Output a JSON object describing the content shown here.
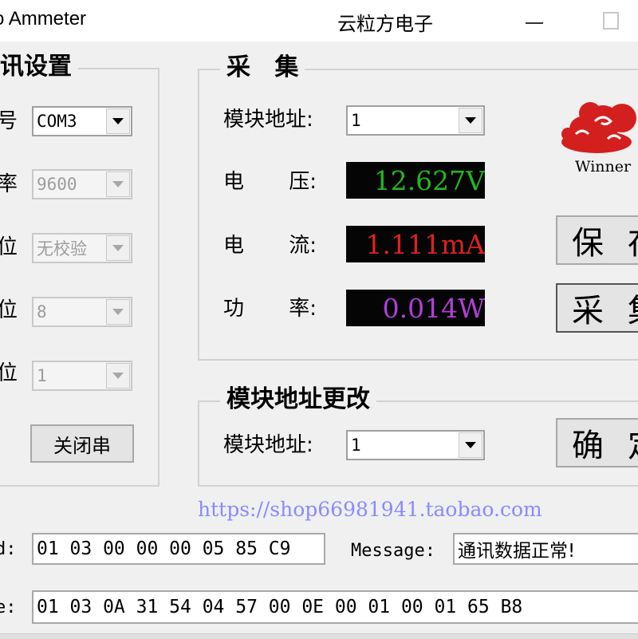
{
  "window": {
    "title": "o Ammeter",
    "vendor": "云粒方电子"
  },
  "comm_settings": {
    "title": "讯设置",
    "rows": [
      {
        "label": "号",
        "value": "COM3",
        "enabled": true
      },
      {
        "label": "率",
        "value": "9600",
        "enabled": false
      },
      {
        "label": "位",
        "value": "无校验",
        "enabled": false
      },
      {
        "label": "位",
        "value": "8",
        "enabled": false
      },
      {
        "label": "位",
        "value": "1",
        "enabled": false
      }
    ],
    "close_button": "关闭串"
  },
  "collect": {
    "title": "采 集",
    "address_label": "模块地址:",
    "address_value": "1",
    "voltage_label": "电 压:",
    "voltage_value": "12.627V",
    "current_label": "电 流:",
    "current_value": "1.111mA",
    "power_label": "功 率:",
    "power_value": "0.014W",
    "logo_text": "Winner",
    "save_button": "保存",
    "collect_button": "采集",
    "colors": {
      "voltage": "#23b623",
      "current": "#e02020",
      "power": "#b040d8",
      "logo_cloud": "#d41f1f"
    }
  },
  "address_change": {
    "title": "模块地址更改",
    "address_label": "模块地址:",
    "address_value": "1",
    "confirm_button": "确定"
  },
  "link": "https://shop66981941.taobao.com",
  "command": {
    "label": "d:",
    "value": "01 03 00 00 00 05 85 C9"
  },
  "message": {
    "label": "Message:",
    "value": "通讯数据正常!"
  },
  "response": {
    "label": "e:",
    "value": "01 03 0A 31 54 04 57 00 0E 00 01 00 01 65 B8"
  }
}
